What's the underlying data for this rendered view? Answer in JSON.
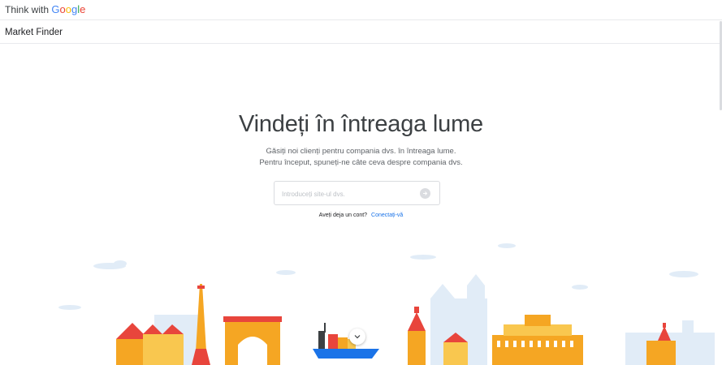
{
  "header": {
    "brand_prefix": "Think with",
    "brand_google_letters": [
      "G",
      "o",
      "o",
      "g",
      "l",
      "e"
    ],
    "product_name": "Market Finder"
  },
  "hero": {
    "headline": "Vindeți în întreaga lume",
    "subtitle_line1": "Găsiți noi clienți pentru compania dvs. în întreaga lume.",
    "subtitle_line2": "Pentru început, spuneți-ne câte ceva despre compania dvs.",
    "site_input": {
      "value": "",
      "placeholder": "Introduceți site-ul dvs."
    },
    "login_question": "Aveți deja un cont?",
    "login_link": "Conectați-vă"
  },
  "colors": {
    "accent_blue": "#1a73e8",
    "google_blue": "#4285f4",
    "google_red": "#ea4335",
    "google_yellow": "#fbbc05",
    "google_green": "#34a853",
    "illustration_orange": "#f5a623",
    "illustration_red": "#e8453c",
    "illustration_sky": "#e1ecf7"
  },
  "icons": {
    "submit": "arrow-right-icon",
    "scroll": "chevron-down-icon"
  }
}
